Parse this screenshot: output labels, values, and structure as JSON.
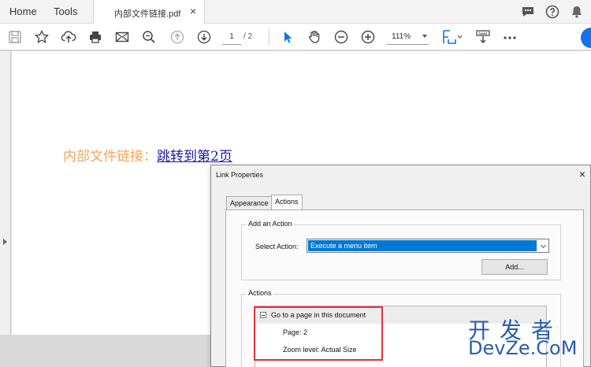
{
  "menu": {
    "home": "Home",
    "tools": "Tools"
  },
  "document_tab": {
    "title": "内部文件链接.pdf",
    "close": "×"
  },
  "top_icons": [
    "comment-icon",
    "help-icon",
    "bell-icon"
  ],
  "toolbar": {
    "icons": [
      "save-icon",
      "bookmark-star-icon",
      "upload-icon",
      "print-icon",
      "email-icon",
      "search-zoom-icon",
      "page-up-icon",
      "page-down-icon",
      "select-arrow-icon",
      "hand-tool-icon",
      "zoom-out-icon",
      "zoom-in-icon",
      "fit-page-icon",
      "scroll-mode-icon",
      "more-icon"
    ],
    "page_current": "1",
    "page_total": "/ 2",
    "zoom": "111%"
  },
  "document": {
    "label": "内部文件链接：",
    "link_text": "跳转到第2页"
  },
  "dialog": {
    "title": "Link Properties",
    "close": "×",
    "tabs": [
      {
        "label": "Appearance",
        "active": false
      },
      {
        "label": "Actions",
        "active": true
      }
    ],
    "add_action": {
      "group_label": "Add an Action",
      "select_label": "Select Action:",
      "selected_value": "Execute a menu item",
      "add_button": "Add..."
    },
    "actions": {
      "group_label": "Actions",
      "items": [
        {
          "label": "Go to a page in this document",
          "details": [
            "Page: 2",
            "Zoom level: Actual Size"
          ]
        }
      ]
    }
  },
  "watermark": {
    "cn": "开发者",
    "en": "DevZe.CoM"
  },
  "colors": {
    "accent_blue": "#1473e6",
    "selection_blue": "#0078d7",
    "document_label": "#f2a65a",
    "link": "#1a1aa8",
    "highlight_red": "#e0333a",
    "watermark": "#2a5db0"
  }
}
